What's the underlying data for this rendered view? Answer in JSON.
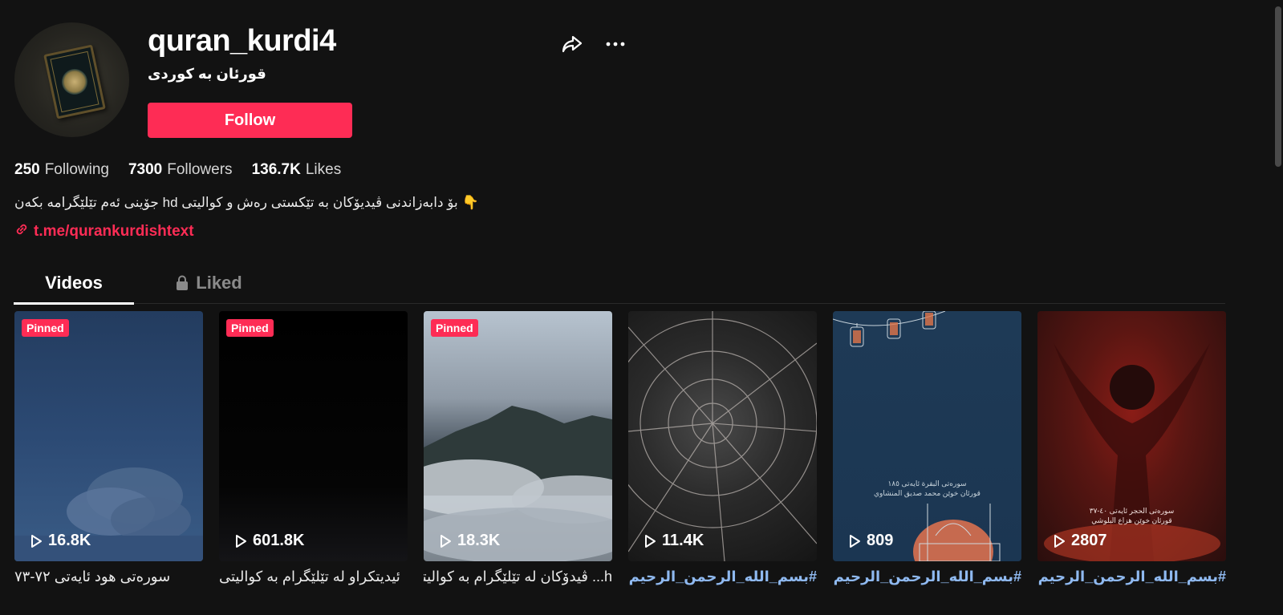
{
  "profile": {
    "username": "quran_kurdi4",
    "nickname": "قورئان بە کوردی",
    "follow_label": "Follow",
    "bio": "جۆینی ئەم تێلێگرامە بکەن hd بۆ دابەزاندنی ڤیدیۆکان بە تێکستی رەش و کوالیتی 👇",
    "link": "t.me/qurankurdishtext"
  },
  "stats": [
    {
      "value": "250",
      "label": "Following"
    },
    {
      "value": "7300",
      "label": "Followers"
    },
    {
      "value": "136.7K",
      "label": "Likes"
    }
  ],
  "tabs": {
    "videos": "Videos",
    "liked": "Liked"
  },
  "videos": [
    {
      "pinned": "Pinned",
      "views": "16.8K",
      "caption": "سورەتی هود ئایەتی ٧٢-٧٣"
    },
    {
      "pinned": "Pinned",
      "views": "601.8K",
      "caption": "ئیدیتکراو لە تێلێگرام بە کوالیتی"
    },
    {
      "pinned": "Pinned",
      "views": "18.3K",
      "caption": "h... ڤیدۆکان لە تێلێگرام بە کوالیتی"
    },
    {
      "pinned": "",
      "views": "11.4K",
      "caption": "#بسم_الله_الرحمن_الرحيم ..."
    },
    {
      "pinned": "",
      "views": "809",
      "caption": "#بسم_الله_الرحمن_الرحيم ..."
    },
    {
      "pinned": "",
      "views": "2807",
      "caption": "#بسم_الله_الرحمن_الرحيم ..."
    }
  ],
  "thumb_text": {
    "v5_line1": "سورەتی البقرة ئایەتی ١٨٥",
    "v5_line2": "قورئان خوێن محمد صديق المنشاوي",
    "v6_line1": "سورەتی الحجر ئایەتی ٤٠-٣٧",
    "v6_line2": "قورئان خوێن هزاع البلوشي"
  },
  "colors": {
    "accent": "#fe2c55",
    "background": "#121212",
    "hashtag": "#8fb9f0"
  }
}
